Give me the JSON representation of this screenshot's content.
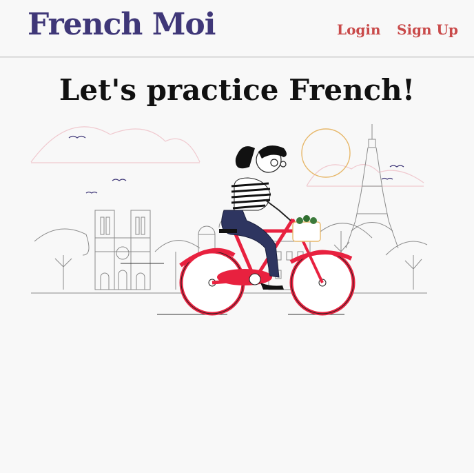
{
  "header": {
    "logo": "French Moi",
    "login_label": "Login",
    "signup_label": "Sign Up"
  },
  "main": {
    "title": "Let's practice French!"
  },
  "colors": {
    "brand": "#3f3778",
    "accent": "#c94a4a",
    "bike": "#e8213f"
  }
}
